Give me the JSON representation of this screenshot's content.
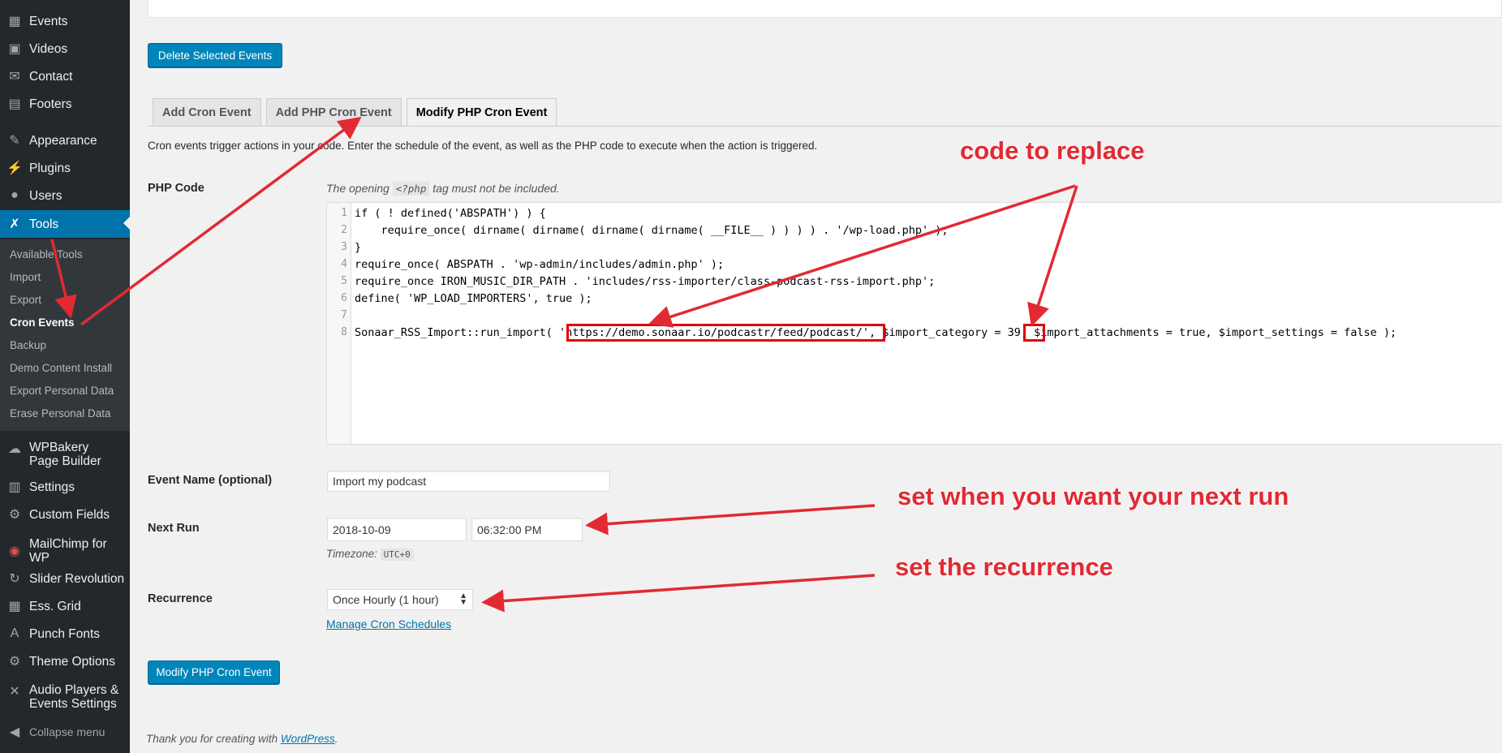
{
  "sidebar": {
    "items": [
      {
        "id": "events",
        "label": "Events",
        "icon": "calendar-icon"
      },
      {
        "id": "videos",
        "label": "Videos",
        "icon": "video-icon"
      },
      {
        "id": "contact",
        "label": "Contact",
        "icon": "mail-icon"
      },
      {
        "id": "footers",
        "label": "Footers",
        "icon": "layout-icon"
      },
      {
        "id": "appearance",
        "label": "Appearance",
        "icon": "paintbrush-icon"
      },
      {
        "id": "plugins",
        "label": "Plugins",
        "icon": "plug-icon"
      },
      {
        "id": "users",
        "label": "Users",
        "icon": "user-icon"
      },
      {
        "id": "tools",
        "label": "Tools",
        "icon": "wrench-icon"
      },
      {
        "id": "wpbakery",
        "label": "WPBakery Page Builder",
        "icon": "cloud-icon"
      },
      {
        "id": "settings",
        "label": "Settings",
        "icon": "settings-icon"
      },
      {
        "id": "custom-fields",
        "label": "Custom Fields",
        "icon": "gear-icon"
      },
      {
        "id": "mailchimp",
        "label": "MailChimp for WP",
        "icon": "mailchimp-icon"
      },
      {
        "id": "slider",
        "label": "Slider Revolution",
        "icon": "refresh-icon"
      },
      {
        "id": "ess-grid",
        "label": "Ess. Grid",
        "icon": "grid-icon"
      },
      {
        "id": "punch-fonts",
        "label": "Punch Fonts",
        "icon": "font-icon"
      },
      {
        "id": "theme-options",
        "label": "Theme Options",
        "icon": "gear-icon"
      },
      {
        "id": "audio-players",
        "label": "Audio Players & Events Settings",
        "icon": "tools-icon"
      }
    ],
    "submenu": [
      "Available Tools",
      "Import",
      "Export",
      "Cron Events",
      "Backup",
      "Demo Content Install",
      "Export Personal Data",
      "Erase Personal Data"
    ],
    "collapse_label": "Collapse menu"
  },
  "main": {
    "delete_button": "Delete Selected Events",
    "tabs": [
      "Add Cron Event",
      "Add PHP Cron Event",
      "Modify PHP Cron Event"
    ],
    "description": "Cron events trigger actions in your code. Enter the schedule of the event, as well as the PHP code to execute when the action is triggered.",
    "php_code_label": "PHP Code",
    "php_hint_before": "The opening",
    "php_hint_code": "<?php",
    "php_hint_after": "tag must not be included.",
    "code_lines": [
      "if ( ! defined('ABSPATH') ) {",
      "    require_once( dirname( dirname( dirname( dirname( __FILE__ ) ) ) ) . '/wp-load.php' );",
      "}",
      "require_once( ABSPATH . 'wp-admin/includes/admin.php' );",
      "require_once IRON_MUSIC_DIR_PATH . 'includes/rss-importer/class-podcast-rss-import.php';",
      "define( 'WP_LOAD_IMPORTERS', true );",
      "",
      "Sonaar_RSS_Import::run_import( 'https://demo.sonaar.io/podcastr/feed/podcast/', $import_category = 39, $import_attachments = true, $import_settings = false );"
    ],
    "line_numbers": [
      "1",
      "2",
      "3",
      "4",
      "5",
      "6",
      "7",
      "8"
    ],
    "event_name_label": "Event Name (optional)",
    "event_name_value": "Import my podcast",
    "next_run_label": "Next Run",
    "next_run_date": "2018-10-09",
    "next_run_time": "06:32:00 PM",
    "timezone_label": "Timezone:",
    "timezone_value": "UTC+0",
    "recurrence_label": "Recurrence",
    "recurrence_value": "Once Hourly (1 hour)",
    "manage_link": "Manage Cron Schedules",
    "submit_button": "Modify PHP Cron Event",
    "footer_text": "Thank you for creating with",
    "footer_link": "WordPress",
    "footer_period": "."
  },
  "annotations": {
    "code_to_replace": "code to replace",
    "set_next_run": "set when you want your next run",
    "set_recurrence": "set the recurrence"
  },
  "colors": {
    "sidebar_bg": "#23282d",
    "submenu_bg": "#32373c",
    "accent": "#0073aa",
    "button_primary": "#0085ba",
    "annotation_red": "#e12a33"
  }
}
